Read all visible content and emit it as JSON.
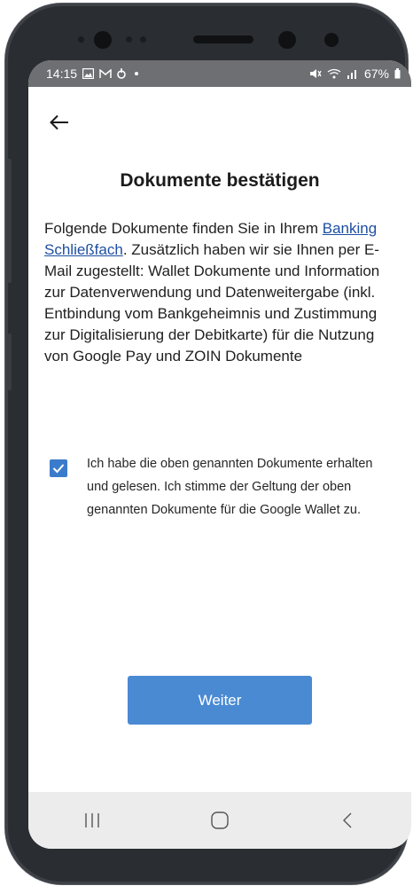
{
  "statusbar": {
    "time": "14:15",
    "left_icons": [
      "gallery-icon",
      "gmail-icon",
      "security-icon",
      "dot-icon"
    ],
    "battery": "67%"
  },
  "header": {
    "back_icon": "arrow-left-icon",
    "title": "Dokumente bestätigen"
  },
  "intro": {
    "part1": "Folgende Dokumente finden Sie in Ihrem ",
    "link": "Banking Schließfach",
    "part2": ". Zusätzlich haben wir sie Ihnen per E-Mail zugestellt: Wallet Dokumente und Information zur Datenverwendung und Datenweitergabe (inkl. Entbindung vom Bankgeheimnis und Zustimmung zur Digitalisierung der Debitkarte) für die Nutzung von Google Pay und ZOIN Dokumente"
  },
  "consent": {
    "checked": true,
    "label": "Ich habe die oben genannten Dokumente erhalten und gelesen. Ich stimme der Geltung der oben genannten Dokumente für die Google Wallet zu."
  },
  "primary_button": "Weiter",
  "navbar": {
    "icons": [
      "recent-apps-icon",
      "home-icon",
      "back-icon"
    ]
  },
  "colors": {
    "accent": "#4a8ad2",
    "checkbox": "#3b7bcb",
    "link": "#1d4ea0",
    "statusbar": "#6e6f73",
    "device": "#2a2d31"
  }
}
